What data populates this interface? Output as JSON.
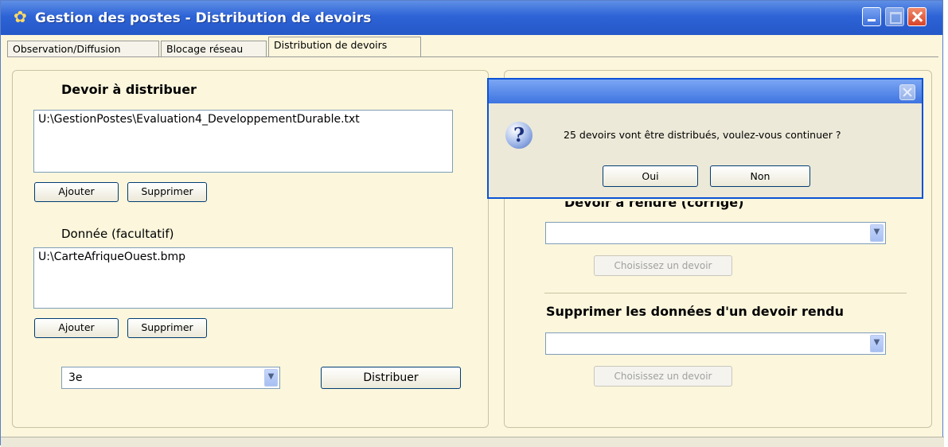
{
  "window": {
    "title": "Gestion des postes - Distribution de devoirs"
  },
  "tabs": [
    {
      "label": "Observation/Diffusion"
    },
    {
      "label": "Blocage réseau"
    },
    {
      "label": "Distribution de devoirs"
    }
  ],
  "left": {
    "devoir_heading": "Devoir à distribuer",
    "devoir_file": "U:\\GestionPostes\\Evaluation4_DeveloppementDurable.txt",
    "ajouter_label": "Ajouter",
    "supprimer_label": "Supprimer",
    "donnee_heading": "Donnée (facultatif)",
    "donnee_file": "U:\\CarteAfriqueOuest.bmp",
    "class_value": "3e",
    "distribuer_label": "Distribuer"
  },
  "right": {
    "rendre_heading_partial": "Devoir à rendre (corrigé)",
    "choisir_label": "Choisissez un devoir",
    "supprimer_heading": "Supprimer  les données d'un devoir rendu"
  },
  "dialog": {
    "message": "25 devoirs vont être distribués, voulez-vous continuer ?",
    "yes_label": "Oui",
    "no_label": "Non",
    "icon": "question-icon"
  },
  "colors": {
    "window_bg": "#fbf6dc",
    "titlebar": "#2d63d6",
    "dialog_bg": "#ece9d8"
  }
}
